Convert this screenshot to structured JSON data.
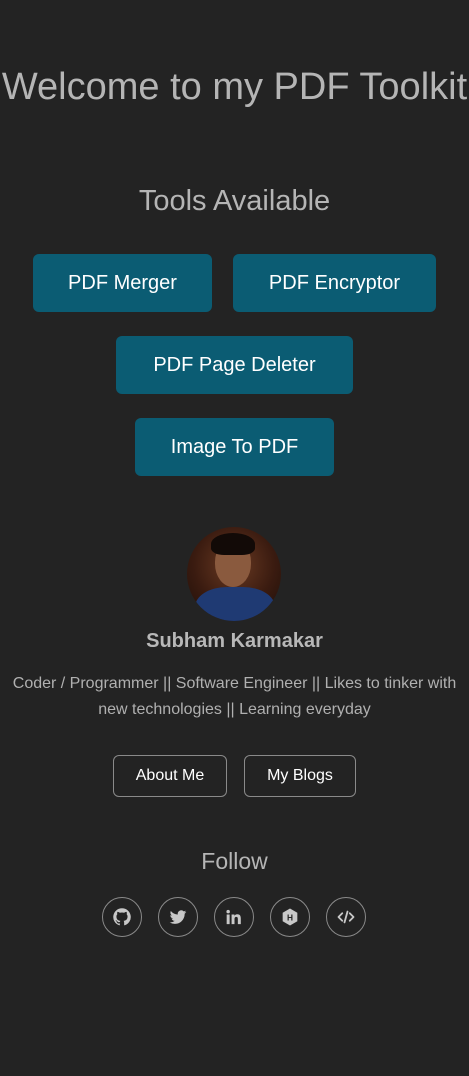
{
  "header": {
    "title": "Welcome to my PDF Toolkit",
    "subtitle": "Tools Available"
  },
  "tools": {
    "merger": "PDF Merger",
    "encryptor": "PDF Encryptor",
    "deleter": "PDF Page Deleter",
    "image_to_pdf": "Image To PDF"
  },
  "profile": {
    "name": "Subham Karmakar",
    "bio": "Coder / Programmer || Software Engineer || Likes to tinker with new technologies || Learning everyday",
    "about_label": "About Me",
    "blogs_label": "My Blogs"
  },
  "follow": {
    "heading": "Follow",
    "icons": [
      "github-icon",
      "twitter-icon",
      "linkedin-icon",
      "hashnode-icon",
      "code-icon"
    ]
  },
  "colors": {
    "background": "#232323",
    "tool_button": "#0b5c73",
    "text": "#b5b5b5"
  }
}
